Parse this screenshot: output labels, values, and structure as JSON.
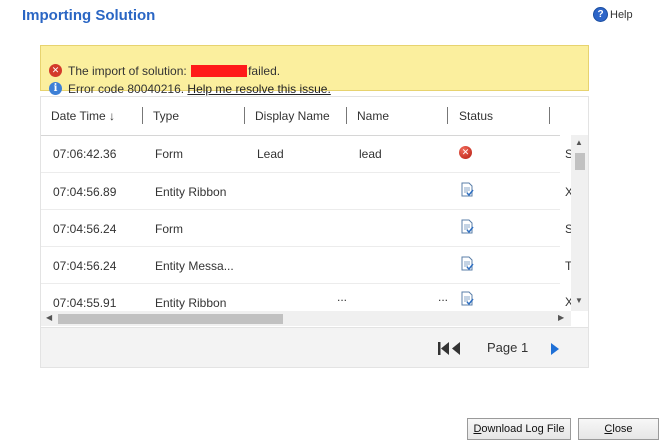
{
  "dialog": {
    "title": "Importing Solution",
    "help_label": "Help"
  },
  "notice": {
    "import_prefix": "The import of solution: ",
    "import_suffix": "failed.",
    "error_prefix": "Error code 80040216. ",
    "help_link": "Help me resolve this issue."
  },
  "grid": {
    "columns": [
      "Date Time ↓",
      "Type",
      "Display Name",
      "Name",
      "Status"
    ],
    "rows": [
      {
        "time": "07:06:42.36",
        "type": "Form",
        "display_name": "Lead",
        "name": "lead",
        "status": "error-icon",
        "extra": "Sy"
      },
      {
        "time": "07:04:56.89",
        "type": "Entity Ribbon",
        "display_name": "",
        "name": "",
        "status": "document-check-icon",
        "extra": "X"
      },
      {
        "time": "07:04:56.24",
        "type": "Form",
        "display_name": "",
        "name": "",
        "status": "document-check-icon",
        "extra": "Sy"
      },
      {
        "time": "07:04:56.24",
        "type": "Entity Messa...",
        "display_name": "",
        "name": "",
        "status": "document-check-icon",
        "extra": "Te"
      },
      {
        "time": "07:04:55.91",
        "type": "Entity Ribbon",
        "display_name": "...",
        "name": "...",
        "status": "document-check-icon",
        "extra": "X"
      }
    ]
  },
  "pager": {
    "label": "Page 1"
  },
  "buttons": {
    "download_first": "D",
    "download_rest": "ownload Log File",
    "close_first": "C",
    "close_rest": "lose"
  },
  "colors": {
    "title": "#2a66c4",
    "notice_bg": "#fbef9e",
    "redacted": "#ff1a1a",
    "next_arrow": "#1e6fd6"
  }
}
